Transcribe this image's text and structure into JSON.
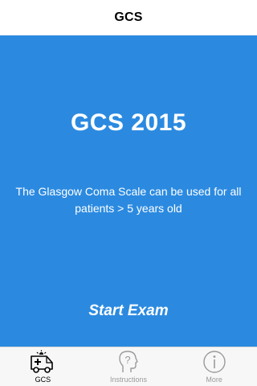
{
  "navbar": {
    "title": "GCS"
  },
  "main": {
    "headline": "GCS 2015",
    "description": "The Glasgow Coma Scale can be used for all patients > 5 years old",
    "start_button_label": "Start Exam",
    "background_color": "#2b8ae0"
  },
  "tabbar": {
    "tabs": [
      {
        "label": "GCS",
        "icon": "ambulance-icon",
        "active": true
      },
      {
        "label": "Instructions",
        "icon": "question-head-icon",
        "active": false
      },
      {
        "label": "More",
        "icon": "info-icon",
        "active": false
      }
    ]
  }
}
